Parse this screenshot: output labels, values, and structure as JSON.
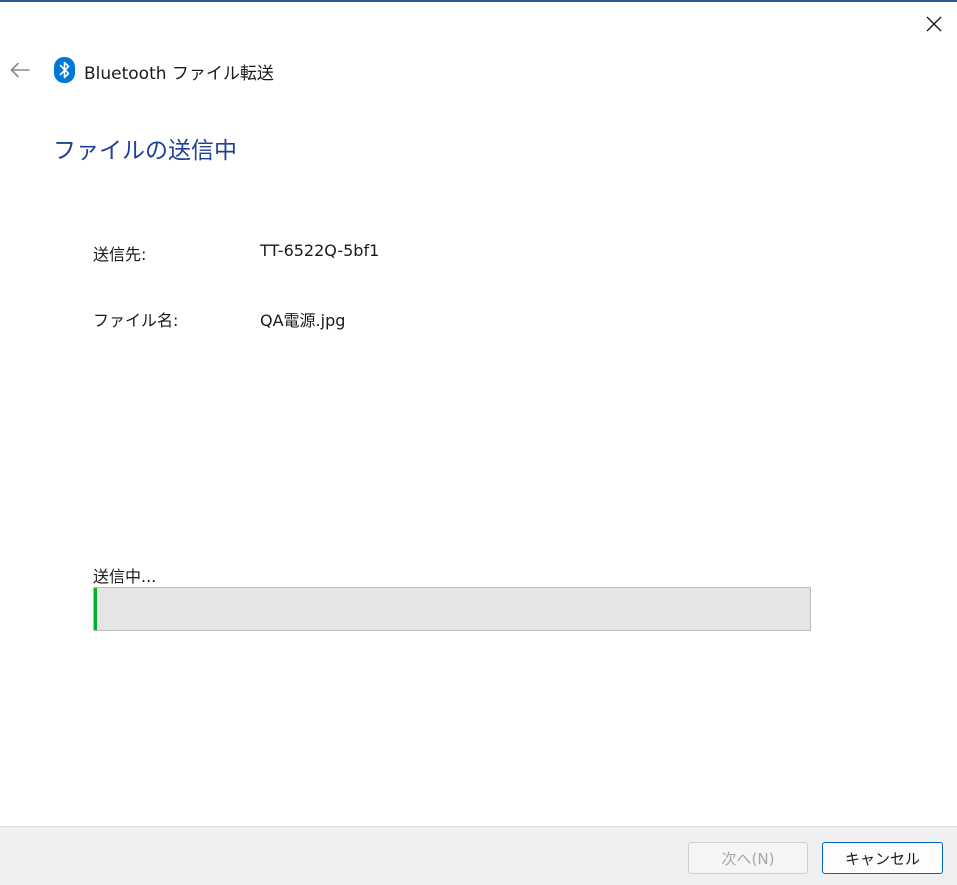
{
  "window": {
    "title": "Bluetooth ファイル転送",
    "icons": {
      "close": "close-icon",
      "back": "back-arrow-icon",
      "app": "bluetooth-icon"
    },
    "colors": {
      "accent_bar": "#2b5797",
      "heading": "#1f3f98",
      "bluetooth": "#0078d7",
      "progress": "#06b025",
      "primary_border": "#0067c0"
    }
  },
  "page": {
    "heading": "ファイルの送信中",
    "destination": {
      "label": "送信先:",
      "value": "TT-6522Q-5bf1"
    },
    "file": {
      "label": "ファイル名:",
      "value": "QA電源.jpg"
    },
    "status_text": "送信中...",
    "progress_percent": 0
  },
  "footer": {
    "next_label": "次へ(N)",
    "next_enabled": false,
    "cancel_label": "キャンセル"
  }
}
